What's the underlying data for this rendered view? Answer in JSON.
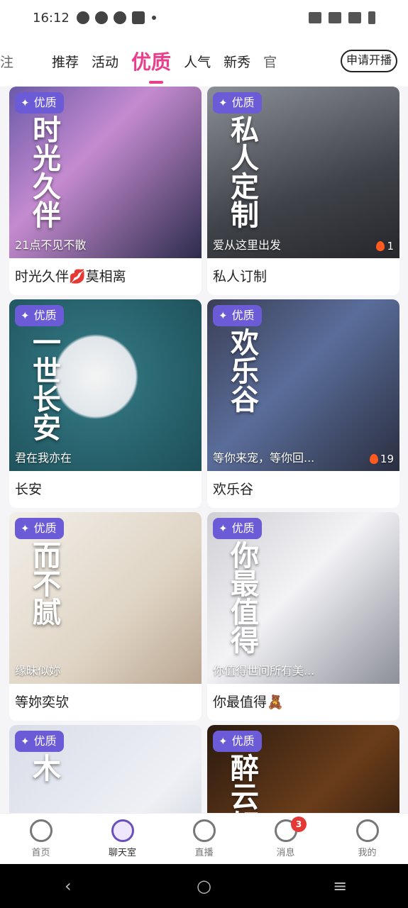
{
  "status": {
    "time": "16:12"
  },
  "tabs": [
    {
      "label": "注",
      "partial": true
    },
    {
      "label": "推荐"
    },
    {
      "label": "活动"
    },
    {
      "label": "优质",
      "active": true
    },
    {
      "label": "人气"
    },
    {
      "label": "新秀"
    },
    {
      "label": "官",
      "partial": true
    }
  ],
  "apply_button": "申请开播",
  "badge_label": "优质",
  "cards": [
    {
      "title": "时光久伴💋莫相离",
      "subtitle": "21点不见不散",
      "hot": "",
      "bg": "linear-gradient(135deg,#6b5aa8 0%,#c58bd0 40%,#2c2c4c 100%)",
      "overlay": "时光久伴"
    },
    {
      "title": "私人订制",
      "subtitle": "爱从这里出发",
      "hot": "1",
      "bg": "linear-gradient(160deg,#8b8f97 0%,#3f4248 60%,#26272b 100%)",
      "overlay": "私人定制"
    },
    {
      "title": "长安",
      "subtitle": "君在我亦在",
      "hot": "",
      "bg": "radial-gradient(circle at 45% 45%,#f4f4f4 0%,#e0e6ea 28%,#2e6f7a 30%,#1e4f58 100%)",
      "overlay": "一世长安"
    },
    {
      "title": "欢乐谷",
      "subtitle": "等你来宠，等你回...",
      "hot": "19",
      "bg": "linear-gradient(135deg,#3a3f55 0%,#5a6d9a 45%,#2a2f3f 100%)",
      "overlay": "欢乐谷"
    },
    {
      "title": "等妳奕欤",
      "subtitle": "缘昧似妳",
      "hot": "",
      "bg": "linear-gradient(135deg,#f2efe9 0%,#dfd4c4 60%,#b9a692 100%)",
      "overlay": "而不腻"
    },
    {
      "title": "你最值得🧸",
      "subtitle": "你值得世间所有美...",
      "hot": "",
      "bg": "linear-gradient(135deg,#cfcfd4 0%,#f3f3f6 45%,#8d8f99 100%)",
      "overlay": "你最值得"
    },
    {
      "title": "",
      "subtitle": "",
      "hot": "",
      "bg": "linear-gradient(135deg,#d9dde8 0%,#eef0f5 60%,#c7cbd6 100%)",
      "overlay": "木"
    },
    {
      "title": "",
      "subtitle": "",
      "hot": "",
      "bg": "linear-gradient(135deg,#2a1a10 0%,#6a3d1a 50%,#1a0f08 100%)",
      "overlay": "醉云轩"
    }
  ],
  "bottom_nav": [
    {
      "label": "首页",
      "icon": "home-icon"
    },
    {
      "label": "聊天室",
      "icon": "chat-room-icon",
      "active": true
    },
    {
      "label": "直播",
      "icon": "live-tv-icon"
    },
    {
      "label": "消息",
      "icon": "message-icon",
      "badge": "3"
    },
    {
      "label": "我的",
      "icon": "profile-icon"
    }
  ]
}
